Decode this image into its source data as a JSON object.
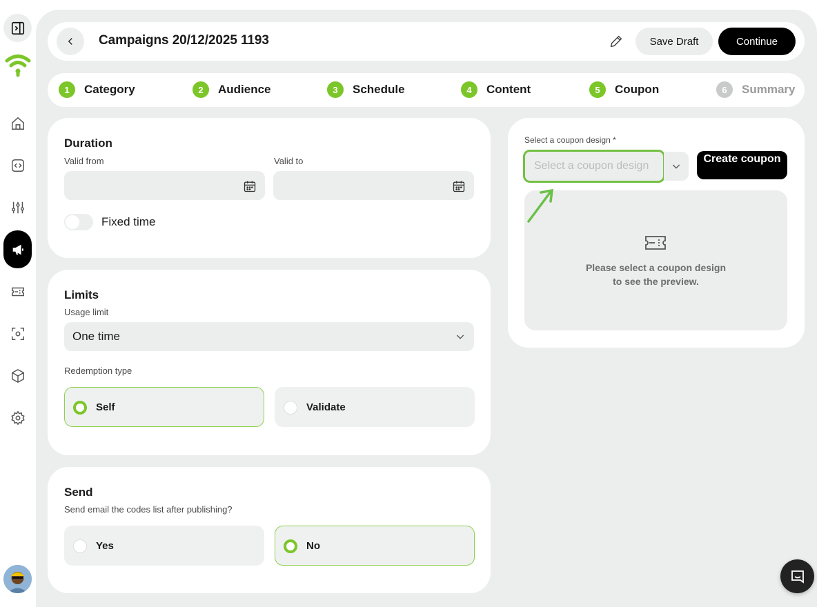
{
  "header": {
    "title": "Campaigns 20/12/2025 1193",
    "save_draft_label": "Save Draft",
    "continue_label": "Continue"
  },
  "steps": [
    {
      "number": "1",
      "label": "Category",
      "state": "complete"
    },
    {
      "number": "2",
      "label": "Audience",
      "state": "complete"
    },
    {
      "number": "3",
      "label": "Schedule",
      "state": "complete"
    },
    {
      "number": "4",
      "label": "Content",
      "state": "complete"
    },
    {
      "number": "5",
      "label": "Coupon",
      "state": "current"
    },
    {
      "number": "6",
      "label": "Summary",
      "state": "pending"
    }
  ],
  "duration": {
    "title": "Duration",
    "valid_from_label": "Valid from",
    "valid_from_value": "",
    "valid_to_label": "Valid to",
    "valid_to_value": "",
    "fixed_time_label": "Fixed time",
    "fixed_time_on": false
  },
  "limits": {
    "title": "Limits",
    "usage_limit_label": "Usage limit",
    "usage_limit_value": "One time",
    "redemption_type_label": "Redemption type",
    "redemption_options": [
      {
        "label": "Self",
        "selected": true
      },
      {
        "label": "Validate",
        "selected": false
      }
    ]
  },
  "send": {
    "title": "Send",
    "question": "Send email the codes list after publishing?",
    "options": [
      {
        "label": "Yes",
        "selected": false
      },
      {
        "label": "No",
        "selected": true
      }
    ]
  },
  "coupon": {
    "select_label": "Select a coupon design *",
    "select_placeholder": "Select a coupon design",
    "create_label": "Create coupon",
    "preview_line1": "Please select a coupon design",
    "preview_line2": "to see the preview."
  },
  "icons": {
    "sidebar": [
      "sidebar-toggle-icon",
      "brand-logo-icon",
      "home-icon",
      "code-icon",
      "sliders-icon",
      "megaphone-icon",
      "ticket-icon",
      "scan-icon",
      "cube-icon",
      "gear-icon"
    ],
    "header": [
      "chevron-left-icon",
      "pencil-icon"
    ],
    "misc": [
      "calendar-icon",
      "chevron-down-icon",
      "ticket-icon",
      "chat-icon"
    ]
  },
  "colors": {
    "accent": "#7cc62a",
    "highlight_border": "#74c043",
    "background": "#eceeed",
    "primary_button": "#000000"
  }
}
